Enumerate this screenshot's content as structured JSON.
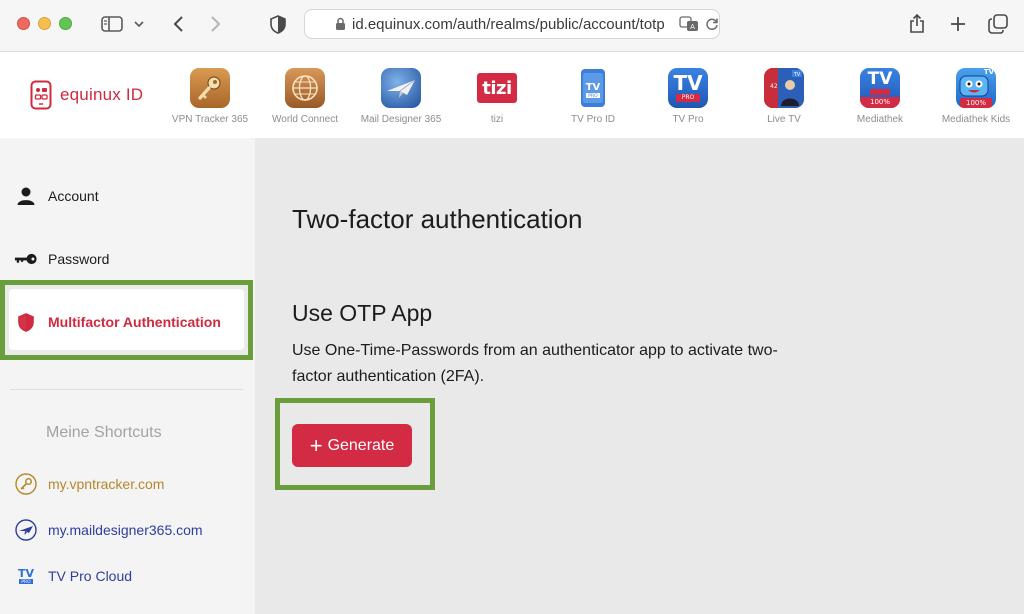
{
  "browser": {
    "url": "id.equinux.com/auth/realms/public/account/totp"
  },
  "brand": {
    "name": "equinux ID",
    "accent_color": "#d1293f"
  },
  "apps": [
    {
      "label": "VPN Tracker 365",
      "icon": "key-app-icon"
    },
    {
      "label": "World Connect",
      "icon": "globe-app-icon"
    },
    {
      "label": "Mail Designer 365",
      "icon": "paper-plane-app-icon"
    },
    {
      "label": "tizi",
      "icon_text": "tizi"
    },
    {
      "label": "TV Pro ID",
      "icon": "phone-tv-app-icon"
    },
    {
      "label": "TV Pro",
      "icon_text": "TV"
    },
    {
      "label": "Live TV",
      "icon": "live-tv-app-icon"
    },
    {
      "label": "Mediathek",
      "icon_text": "TV"
    },
    {
      "label": "Mediathek Kids",
      "icon_text": "TV"
    }
  ],
  "sidebar": {
    "items": [
      {
        "label": "Account",
        "icon": "user-icon"
      },
      {
        "label": "Password",
        "icon": "key-icon"
      },
      {
        "label": "Multifactor Authentication",
        "icon": "shield-icon",
        "active": true
      }
    ],
    "shortcuts_title": "Meine Shortcuts",
    "shortcuts": [
      {
        "label": "my.vpntracker.com",
        "color": "#b8862b"
      },
      {
        "label": "my.maildesigner365.com",
        "color": "#2f3e9c"
      },
      {
        "label": "TV Pro Cloud",
        "color": "#2f3e9c"
      }
    ]
  },
  "main": {
    "title": "Two-factor authentication",
    "section_title": "Use OTP App",
    "section_desc": "Use One-Time-Passwords from an authenticator app to activate two-factor authentication (2FA).",
    "generate_label": "Generate",
    "highlight_color": "#6a9e3c",
    "button_color": "#d32b43"
  }
}
